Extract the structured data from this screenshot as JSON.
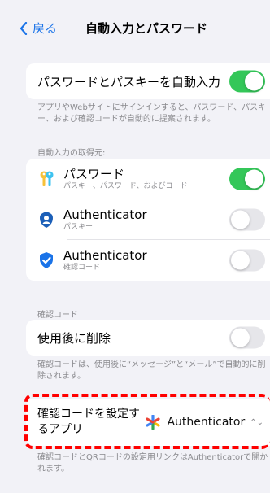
{
  "nav": {
    "back_label": "戻る",
    "title": "自動入力とパスワード"
  },
  "autofill": {
    "label": "パスワードとパスキーを自動入力",
    "enabled": true,
    "footnote": "アプリやWebサイトにサインインすると、パスワード、パスキー、および確認コードが自動的に提案されます。"
  },
  "sources": {
    "header": "自動入力の取得元:",
    "items": [
      {
        "name": "パスワード",
        "sub": "パスキー、パスワード、およびコード",
        "enabled": true,
        "icon": "passwords-key-icon"
      },
      {
        "name": "Authenticator",
        "sub": "パスキー",
        "enabled": false,
        "icon": "microsoft-authenticator-icon"
      },
      {
        "name": "Authenticator",
        "sub": "確認コード",
        "enabled": false,
        "icon": "shield-check-icon"
      }
    ]
  },
  "codes": {
    "header": "確認コード",
    "delete_label": "使用後に削除",
    "delete_enabled": false,
    "delete_footnote": "確認コードは、使用後に“メッセージ”と“メール”で自動的に削除されます。",
    "setup_label": "確認コードを設定するアプリ",
    "setup_value": "Authenticator",
    "setup_footnote": "確認コードとQRコードの設定用リンクはAuthenticatorで開かれます。"
  },
  "colors": {
    "accent": "#1a73e8",
    "toggle_on": "#34c759",
    "highlight": "#ff0000"
  }
}
